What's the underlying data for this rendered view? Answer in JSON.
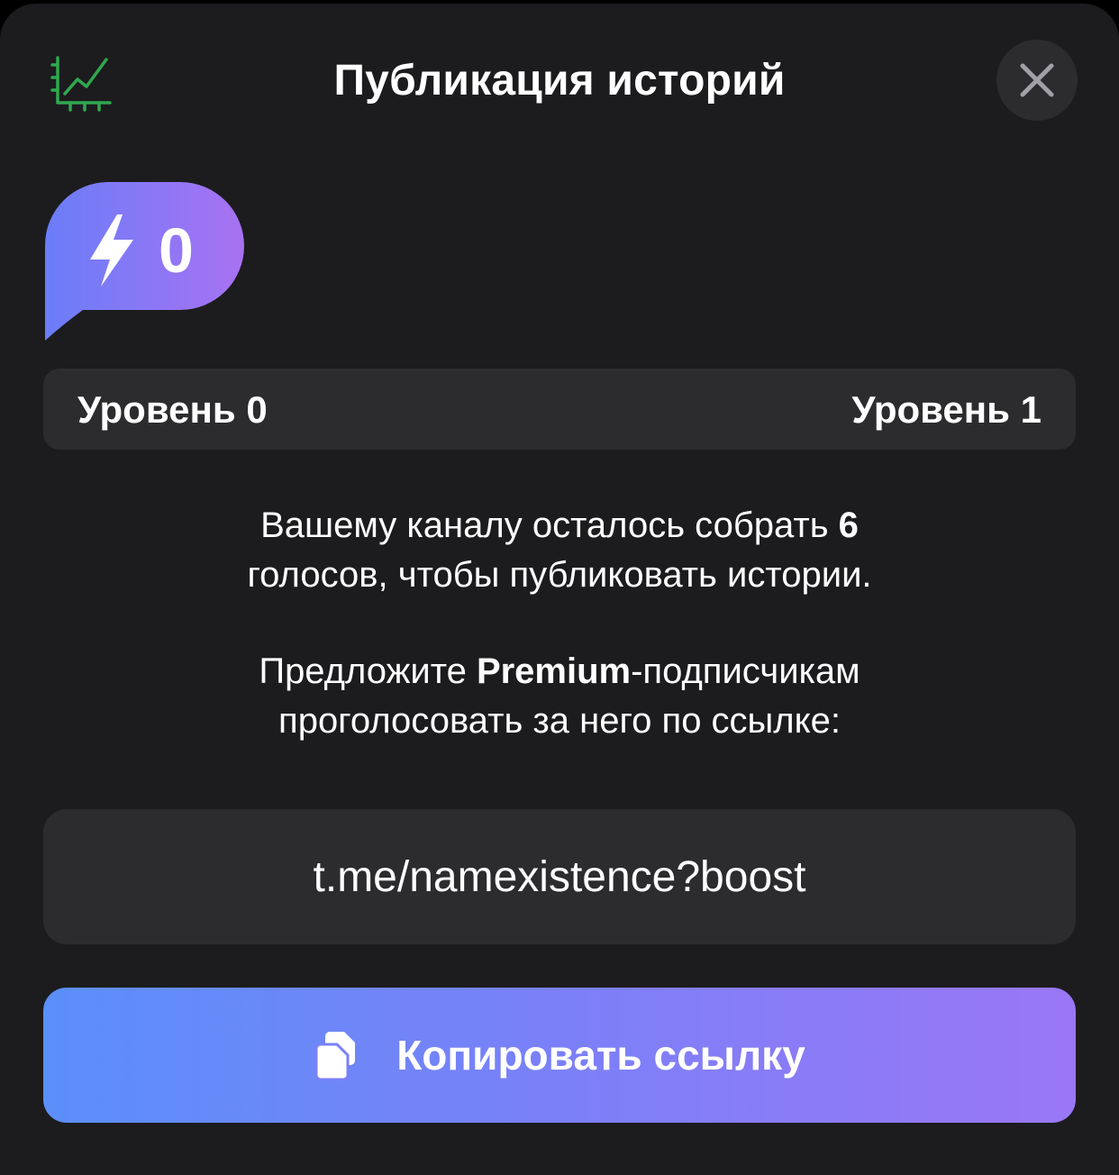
{
  "header": {
    "title": "Публикация историй",
    "stats_icon": "stats-chart-icon",
    "close_icon": "close-icon"
  },
  "boost_badge": {
    "icon": "lightning-bolt-icon",
    "count": "0"
  },
  "levels": {
    "current": "Уровень 0",
    "next": "Уровень 1"
  },
  "description": {
    "line1_pre": "Вашему каналу осталось собрать ",
    "line1_count": "6",
    "line1_post": "голосов, чтобы публиковать истории.",
    "line2_pre": "Предложите ",
    "line2_bold": "Premium",
    "line2_post": "-подписчикам",
    "line2_end": "проголосовать за него по ссылке:"
  },
  "link": {
    "url": "t.me/namexistence?boost"
  },
  "copy_button": {
    "label": "Копировать ссылку",
    "icon": "copy-icon"
  },
  "colors": {
    "background": "#1c1c1e",
    "surface": "#2c2c2e",
    "accent_green": "#2fa84f",
    "gradient_start": "#5b8ff9",
    "gradient_end": "#9a77f5"
  }
}
